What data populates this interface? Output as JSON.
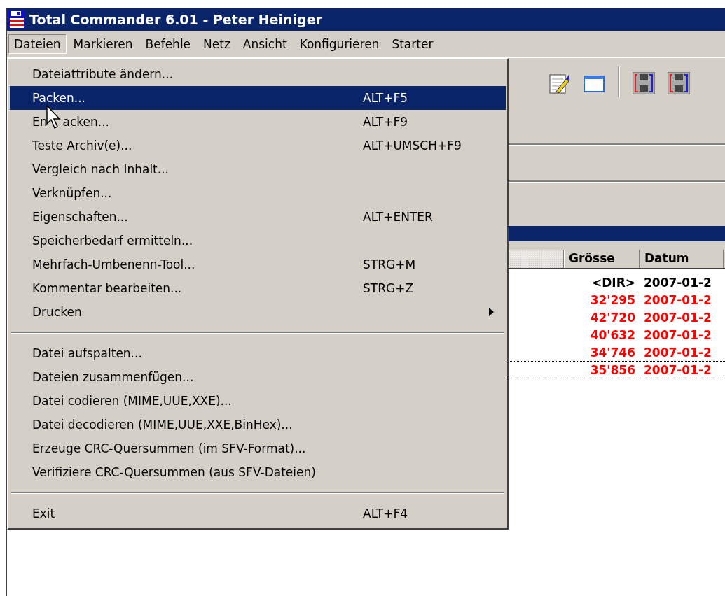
{
  "window": {
    "title": "Total Commander 6.01 - Peter Heiniger"
  },
  "menu_bar": [
    {
      "label": "Dateien",
      "selected": true
    },
    {
      "label": "Markieren",
      "selected": false
    },
    {
      "label": "Befehle",
      "selected": false
    },
    {
      "label": "Netz",
      "selected": false
    },
    {
      "label": "Ansicht",
      "selected": false
    },
    {
      "label": "Konfigurieren",
      "selected": false
    },
    {
      "label": "Starter",
      "selected": false
    }
  ],
  "dropdown": [
    {
      "kind": "item",
      "label": "Dateiattribute ändern...",
      "selected": false
    },
    {
      "kind": "item",
      "label": "Packen...",
      "shortcut": "ALT+F5",
      "selected": true
    },
    {
      "kind": "item",
      "label_parts": [
        "En",
        "acken..."
      ],
      "shortcut": "ALT+F9",
      "selected": false
    },
    {
      "kind": "item",
      "label": "Teste Archiv(e)...",
      "shortcut": "ALT+UMSCH+F9",
      "selected": false
    },
    {
      "kind": "item",
      "label": "Vergleich nach Inhalt...",
      "selected": false
    },
    {
      "kind": "item",
      "label": "Verknüpfen...",
      "selected": false
    },
    {
      "kind": "item",
      "label": "Eigenschaften...",
      "shortcut": "ALT+ENTER",
      "selected": false
    },
    {
      "kind": "item",
      "label": "Speicherbedarf ermitteln...",
      "selected": false
    },
    {
      "kind": "item",
      "label": "Mehrfach-Umbenenn-Tool...",
      "shortcut": "STRG+M",
      "selected": false
    },
    {
      "kind": "item",
      "label": "Kommentar bearbeiten...",
      "shortcut": "STRG+Z",
      "selected": false
    },
    {
      "kind": "submenu",
      "label": "Drucken",
      "selected": false
    },
    {
      "kind": "separator"
    },
    {
      "kind": "item",
      "label": "Datei aufspalten...",
      "selected": false
    },
    {
      "kind": "item",
      "label": "Dateien zusammenfügen...",
      "selected": false
    },
    {
      "kind": "item",
      "label": "Datei codieren (MIME,UUE,XXE)...",
      "selected": false
    },
    {
      "kind": "item",
      "label": "Datei decodieren (MIME,UUE,XXE,BinHex)...",
      "selected": false
    },
    {
      "kind": "item",
      "label": "Erzeuge CRC-Quersummen (im SFV-Format)...",
      "selected": false
    },
    {
      "kind": "item",
      "label": "Verifiziere CRC-Quersummen (aus SFV-Dateien)",
      "selected": false
    },
    {
      "kind": "separator"
    },
    {
      "kind": "item",
      "label": "Exit",
      "shortcut": "ALT+F4",
      "selected": false
    }
  ],
  "file_list": {
    "columns": [
      "Grösse",
      "Datum"
    ],
    "rows": [
      {
        "size": "<DIR>",
        "date": "2007-01-2",
        "color": "#000000",
        "focused": false
      },
      {
        "size": "32'295",
        "date": "2007-01-2",
        "color": "#ff0000",
        "focused": false
      },
      {
        "size": "42'720",
        "date": "2007-01-2",
        "color": "#ff0000",
        "focused": false
      },
      {
        "size": "40'632",
        "date": "2007-01-2",
        "color": "#ff0000",
        "focused": false
      },
      {
        "size": "34'746",
        "date": "2007-01-2",
        "color": "#ff0000",
        "focused": false
      },
      {
        "size": "35'856",
        "date": "2007-01-2",
        "color": "#ff0000",
        "focused": true
      }
    ]
  }
}
